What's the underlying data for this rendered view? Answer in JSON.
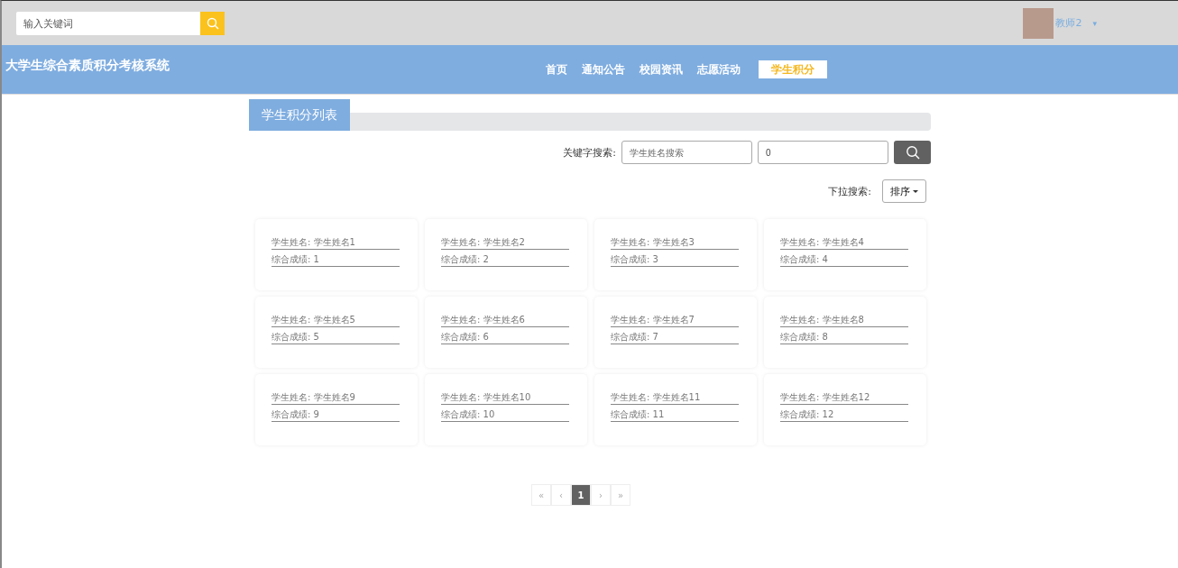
{
  "top_bar": {
    "search": {
      "placeholder": "输入关键词"
    },
    "user": {
      "name": "教师2",
      "caret": "▾"
    }
  },
  "header": {
    "title": "大学生综合素质积分考核系统",
    "nav": [
      {
        "label": "首页",
        "selected": false
      },
      {
        "label": "通知公告",
        "selected": false
      },
      {
        "label": "校园资讯",
        "selected": false
      },
      {
        "label": "志愿活动",
        "selected": false
      },
      {
        "label": "学生积分",
        "selected": true
      }
    ]
  },
  "panel": {
    "title": "学生积分列表",
    "keyword_label": "关键字搜索:",
    "name_search": {
      "placeholder": "学生姓名搜索"
    },
    "score_search": {
      "value": "0"
    },
    "dropdown_label": "下拉搜索:",
    "sort_button": "排序"
  },
  "cards": [
    {
      "lines": [
        "学生姓名: 学生姓名1",
        "综合成绩: 1"
      ]
    },
    {
      "lines": [
        "学生姓名: 学生姓名2",
        "综合成绩: 2"
      ]
    },
    {
      "lines": [
        "学生姓名: 学生姓名3",
        "综合成绩: 3"
      ]
    },
    {
      "lines": [
        "学生姓名: 学生姓名4",
        "综合成绩: 4"
      ]
    },
    {
      "lines": [
        "学生姓名: 学生姓名5",
        "综合成绩: 5"
      ]
    },
    {
      "lines": [
        "学生姓名: 学生姓名6",
        "综合成绩: 6"
      ]
    },
    {
      "lines": [
        "学生姓名: 学生姓名7",
        "综合成绩: 7"
      ]
    },
    {
      "lines": [
        "学生姓名: 学生姓名8",
        "综合成绩: 8"
      ]
    },
    {
      "lines": [
        "学生姓名: 学生姓名9",
        "综合成绩: 9"
      ]
    },
    {
      "lines": [
        "学生姓名: 学生姓名10",
        "综合成绩: 10"
      ]
    },
    {
      "lines": [
        "学生姓名: 学生姓名11",
        "综合成绩: 11"
      ]
    },
    {
      "lines": [
        "学生姓名: 学生姓名12",
        "综合成绩: 12"
      ]
    }
  ],
  "pagination": [
    {
      "label": "«",
      "selected": false
    },
    {
      "label": "‹",
      "selected": false
    },
    {
      "label": "1",
      "selected": true
    },
    {
      "label": "›",
      "selected": false
    },
    {
      "label": "»",
      "selected": false
    }
  ]
}
